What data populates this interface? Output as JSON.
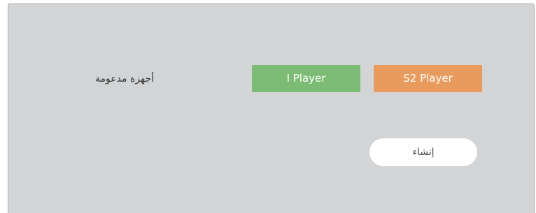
{
  "devices": {
    "label": "أجهزة مدعومة",
    "buttons": [
      {
        "label": "I Player",
        "color": "#7cbb73"
      },
      {
        "label": "S2 Player",
        "color": "#e99a5d"
      }
    ]
  },
  "actions": {
    "create_label": "إنشاء"
  }
}
